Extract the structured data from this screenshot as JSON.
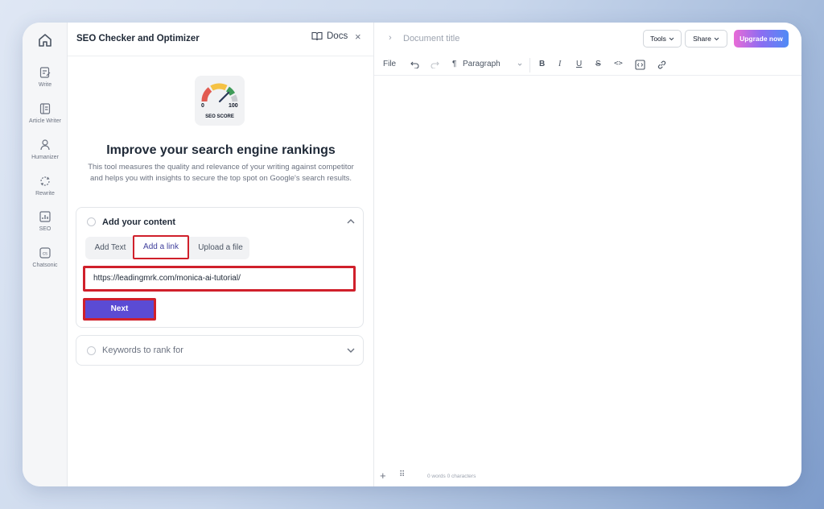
{
  "rail": {
    "items": [
      {
        "label": "Write",
        "icon": "write-icon"
      },
      {
        "label": "Article Writer",
        "icon": "article-icon"
      },
      {
        "label": "Humanizer",
        "icon": "user-icon"
      },
      {
        "label": "Rewrite",
        "icon": "rewrite-icon"
      },
      {
        "label": "SEO",
        "icon": "chart-icon"
      },
      {
        "label": "Chatsonic",
        "icon": "chatsonic-icon"
      }
    ]
  },
  "panel": {
    "title": "SEO Checker and Optimizer",
    "docs_label": "Docs",
    "close": "×",
    "score": {
      "min": "0",
      "max": "100",
      "caption": "SEO SCORE"
    },
    "headline": "Improve your search engine rankings",
    "description": "This tool measures the quality and relevance of your writing against competitor and helps you with insights to secure the top spot on Google's search results.",
    "content_card": {
      "title": "Add your content",
      "tabs": [
        "Add Text",
        "Add a link",
        "Upload a file"
      ],
      "active_tab": "Add a link",
      "url_value": "https://leadingmrk.com/monica-ai-tutorial/",
      "next_label": "Next"
    },
    "keywords_card": {
      "title": "Keywords to rank for"
    }
  },
  "editor": {
    "doc_title": "Document title",
    "tools_label": "Tools",
    "share_label": "Share",
    "upgrade_label": "Upgrade now",
    "toolbar": {
      "file": "File",
      "paragraph": "Paragraph"
    },
    "footer": {
      "counts": "0 words   0 characters"
    }
  },
  "colors": {
    "accent": "#5b4bd4",
    "highlight": "#d0202b"
  }
}
